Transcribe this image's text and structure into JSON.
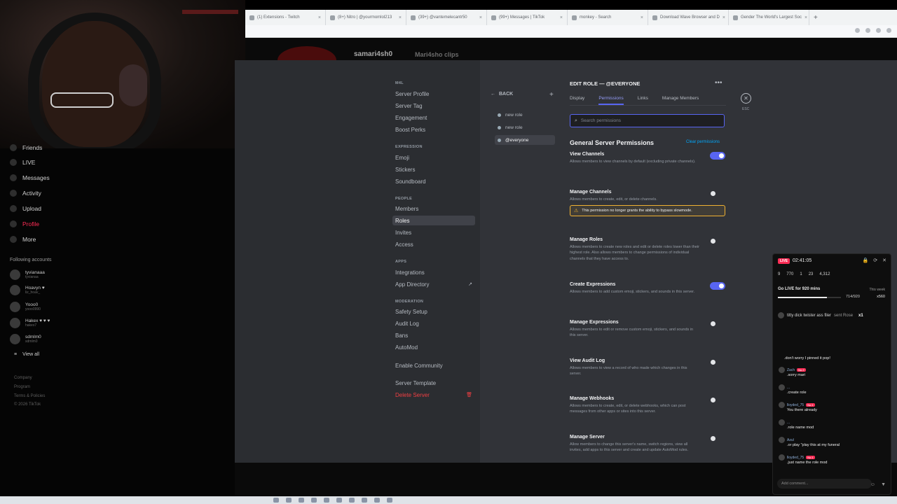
{
  "browser": {
    "tabs": [
      {
        "title": "(1) Extensions - Twitch"
      },
      {
        "title": "(8+) Nitro | @yourmomlol213"
      },
      {
        "title": "(39+) @vantemelecantr50"
      },
      {
        "title": "(99+) Messages | TikTok"
      },
      {
        "title": "monkey - Search"
      },
      {
        "title": "Download Wave Browser and D"
      },
      {
        "title": "Gender The World's Largest Soc"
      }
    ],
    "new_tab": "+"
  },
  "tiktok": {
    "username": "samari4sh0",
    "subtitle": "Mari4sho clips",
    "nav": [
      {
        "label": "Friends",
        "icon": "friends-icon"
      },
      {
        "label": "LIVE",
        "icon": "live-icon"
      },
      {
        "label": "Messages",
        "icon": "messages-icon"
      },
      {
        "label": "Activity",
        "icon": "activity-icon"
      },
      {
        "label": "Upload",
        "icon": "upload-icon"
      },
      {
        "label": "Profile",
        "icon": "profile-icon"
      },
      {
        "label": "More",
        "icon": "more-icon"
      }
    ],
    "following_header": "Following accounts",
    "following": [
      {
        "name": "tyvianaaa",
        "handle": "tyvianaa"
      },
      {
        "name": "Hoavyn ♥",
        "handle": "liz_hoav_"
      },
      {
        "name": "Yooo0",
        "handle": "yooo0990"
      },
      {
        "name": "Hakex ♥ ♥ ♥",
        "handle": "hakex7"
      },
      {
        "name": "sdmlm0",
        "handle": "sdmlm0"
      }
    ],
    "view_all": "View all",
    "footer": [
      "Company",
      "Program",
      "Terms & Policies",
      "© 2026 TikTok"
    ]
  },
  "discord": {
    "sidebar": {
      "server_name": "M4L",
      "groups": [
        {
          "items": [
            {
              "label": "Server Profile"
            },
            {
              "label": "Server Tag"
            },
            {
              "label": "Engagement"
            },
            {
              "label": "Boost Perks"
            }
          ]
        },
        {
          "header": "EXPRESSION",
          "items": [
            {
              "label": "Emoji"
            },
            {
              "label": "Stickers"
            },
            {
              "label": "Soundboard"
            }
          ]
        },
        {
          "header": "PEOPLE",
          "items": [
            {
              "label": "Members"
            },
            {
              "label": "Roles"
            },
            {
              "label": "Invites"
            },
            {
              "label": "Access"
            }
          ]
        },
        {
          "header": "APPS",
          "items": [
            {
              "label": "Integrations"
            },
            {
              "label": "App Directory"
            }
          ]
        },
        {
          "header": "MODERATION",
          "items": [
            {
              "label": "Safety Setup"
            },
            {
              "label": "Audit Log"
            },
            {
              "label": "Bans"
            },
            {
              "label": "AutoMod"
            }
          ]
        },
        {
          "items": [
            {
              "label": "Enable Community"
            }
          ]
        },
        {
          "items": [
            {
              "label": "Server Template"
            },
            {
              "label": "Delete Server"
            }
          ]
        }
      ]
    },
    "back_label": "BACK",
    "roles": [
      {
        "name": "new role"
      },
      {
        "name": "new role"
      },
      {
        "name": "@everyone"
      }
    ],
    "edit_role_title": "EDIT ROLE — @EVERYONE",
    "tabs": [
      {
        "label": "Display"
      },
      {
        "label": "Permissions"
      },
      {
        "label": "Links"
      },
      {
        "label": "Manage Members"
      }
    ],
    "active_tab": "Permissions",
    "esc_label": "ESC",
    "search_placeholder": "Search permissions",
    "section_title": "General Server Permissions",
    "clear_label": "Clear permissions",
    "warning_text": "This permission no longer grants the ability to bypass slowmode.",
    "permissions": [
      {
        "title": "View Channels",
        "desc": "Allows members to view channels by default (excluding private channels).",
        "enabled": true
      },
      {
        "title": "Manage Channels",
        "desc": "Allows members to create, edit, or delete channels.",
        "enabled": false
      },
      {
        "title": "Manage Roles",
        "desc": "Allows members to create new roles and edit or delete roles lower than their highest role. Also allows members to change permissions of individual channels that they have access to.",
        "enabled": false
      },
      {
        "title": "Create Expressions",
        "desc": "Allows members to add custom emoji, stickers, and sounds in this server.",
        "enabled": true
      },
      {
        "title": "Manage Expressions",
        "desc": "Allows members to edit or remove custom emoji, stickers, and sounds in this server.",
        "enabled": false
      },
      {
        "title": "View Audit Log",
        "desc": "Allows members to view a record of who made which changes in this server.",
        "enabled": false
      },
      {
        "title": "Manage Webhooks",
        "desc": "Allows members to create, edit, or delete webhooks, which can post messages from other apps or sites into this server.",
        "enabled": false
      },
      {
        "title": "Manage Server",
        "desc": "Allow members to change this server's name, switch regions, view all invites, add apps to this server and create and update AutoMod rules.",
        "enabled": false
      }
    ]
  },
  "live": {
    "badge": "LIVE",
    "time": "02:41:05",
    "stats": [
      "9",
      "770",
      "1",
      "23",
      "4,312"
    ],
    "goal_label": "Go LIVE for 920 mins",
    "goal_period": "This week",
    "goal_progress": "714/920",
    "goal_fraction": 0.776,
    "gift_count": "x560",
    "gift_message": {
      "user": "titty dick twister ass filer",
      "action": "sent Rose",
      "count": "x1"
    },
    "comments": [
      {
        "user": "",
        "text": ".don't worry I pinned it pop!"
      },
      {
        "user": "Zach",
        "badge": "No.2",
        "text": ".sorry mari"
      },
      {
        "user": "...",
        "text": ".create role"
      },
      {
        "user": "lloyded_75",
        "badge": "No.1",
        "text": "You there already"
      },
      {
        "user": "...",
        "text": ".role name mod"
      },
      {
        "user": "Azul",
        "text": ".or play \"play this at my funeral"
      },
      {
        "user": "lloyded_75",
        "badge": "No.1",
        "text": ".just name the role mod"
      }
    ],
    "add_comment_placeholder": "Add comment..."
  }
}
